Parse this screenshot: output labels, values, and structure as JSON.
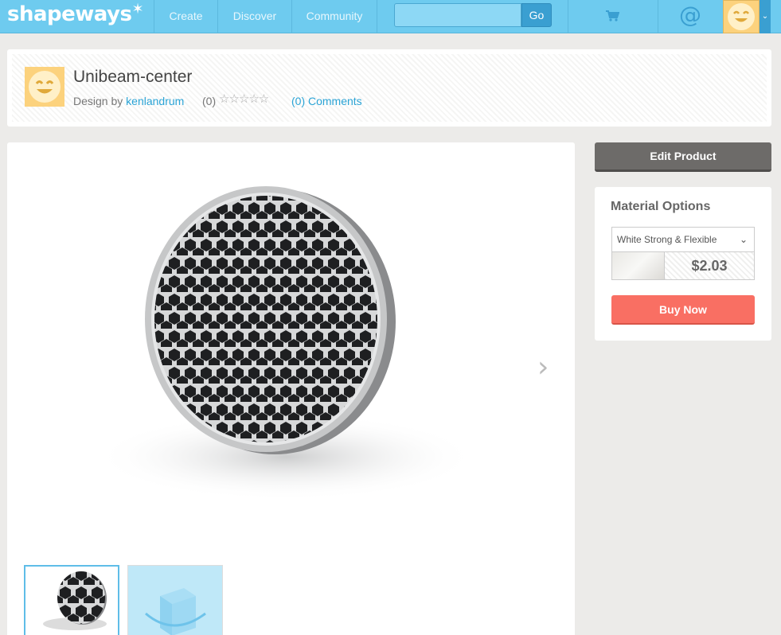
{
  "nav": {
    "logo": "shapeways",
    "logo_mark": "✶",
    "items": [
      "Create",
      "Discover",
      "Community"
    ],
    "search_placeholder": "",
    "go_label": "Go",
    "at_symbol": "@",
    "icons": [
      "cart-icon",
      "at-icon",
      "avatar-smiley-icon",
      "chevron-down-icon"
    ]
  },
  "product": {
    "title": "Unibeam-center",
    "design_by_label": "Design by",
    "designer": "kenlandrum",
    "rating_count": "(0)",
    "stars": "☆☆☆☆☆",
    "comments": "(0) Comments"
  },
  "viewer": {
    "next_arrow": "›",
    "thumbnails": [
      "honeycomb-disc",
      "3d-view-cube"
    ]
  },
  "sidebar": {
    "edit_label": "Edit Product",
    "material_title": "Material Options",
    "material_selected": "White Strong & Flexible",
    "price": "$2.03",
    "buy_label": "Buy Now"
  },
  "colors": {
    "nav_bg": "#6ecbef",
    "link": "#2ba4d6",
    "buy": "#f96f63",
    "edit": "#6d6b69",
    "avatar": "#fcd27d"
  }
}
